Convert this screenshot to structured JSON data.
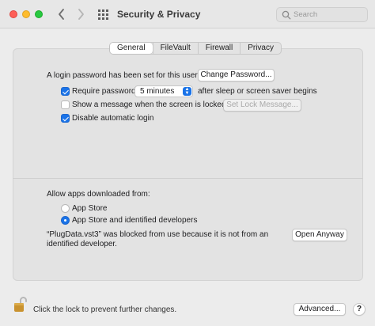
{
  "window": {
    "title": "Security & Privacy",
    "search_placeholder": "Search"
  },
  "tabs": [
    {
      "label": "General",
      "active": true
    },
    {
      "label": "FileVault",
      "active": false
    },
    {
      "label": "Firewall",
      "active": false
    },
    {
      "label": "Privacy",
      "active": false
    }
  ],
  "general": {
    "login_password_text": "A login password has been set for this user",
    "change_password_button": "Change Password...",
    "require_password_label": "Require password",
    "require_password_checked": true,
    "require_password_delay": "5 minutes",
    "require_password_suffix": "after sleep or screen saver begins",
    "show_message_label": "Show a message when the screen is locked",
    "show_message_checked": false,
    "set_lock_message_button": "Set Lock Message...",
    "disable_auto_login_label": "Disable automatic login",
    "disable_auto_login_checked": true
  },
  "downloads": {
    "heading": "Allow apps downloaded from:",
    "option_app_store": "App Store",
    "option_app_store_identified": "App Store and identified developers",
    "selected": "App Store and identified developers",
    "blocked_message_line1": "“PlugData.vst3” was blocked from use because it is not from an",
    "blocked_message_line2": "identified developer.",
    "open_anyway_button": "Open Anyway"
  },
  "footer": {
    "lock_text": "Click the lock to prevent further changes.",
    "advanced_button": "Advanced...",
    "help_button": "?"
  },
  "icons": {
    "back": "chevron-left-icon",
    "forward": "chevron-right-icon",
    "grid": "grid-icon",
    "search": "search-icon",
    "lock": "lock-open-icon"
  },
  "colors": {
    "accent": "#1a73e8",
    "close": "#fe5f57",
    "minimize": "#febc2e",
    "zoom": "#28c840",
    "lock": "#c9922f"
  }
}
